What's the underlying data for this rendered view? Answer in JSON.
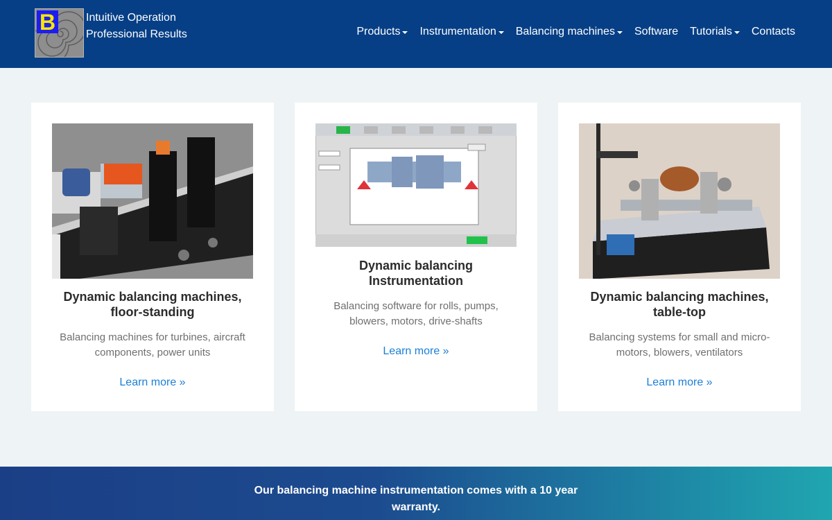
{
  "header": {
    "logo_letter": "B",
    "tagline_line1": "Intuitive Operation",
    "tagline_line2": "Professional Results",
    "nav": [
      {
        "label": "Products",
        "dropdown": true
      },
      {
        "label": "Instrumentation",
        "dropdown": true
      },
      {
        "label": "Balancing machines",
        "dropdown": true
      },
      {
        "label": "Software",
        "dropdown": false
      },
      {
        "label": "Tutorials",
        "dropdown": true
      },
      {
        "label": "Contacts",
        "dropdown": false
      }
    ]
  },
  "cards": [
    {
      "title": "Dynamic balancing machines, floor-standing",
      "description": "Balancing machines for turbines, aircraft components, power units",
      "link": "Learn more »"
    },
    {
      "title": "Dynamic balancing Instrumentation",
      "description": "Balancing software for rolls, pumps, blowers, motors, drive-shafts",
      "link": "Learn more »"
    },
    {
      "title": "Dynamic balancing machines, table-top",
      "description": "Balancing systems for small and micro-motors, blowers, ventilators",
      "link": "Learn more »"
    }
  ],
  "banner": {
    "text": "Our balancing machine instrumentation comes with a 10 year warranty."
  },
  "colors": {
    "header_bg": "#063f86",
    "page_bg": "#eef3f5",
    "link": "#1a7fd6"
  }
}
